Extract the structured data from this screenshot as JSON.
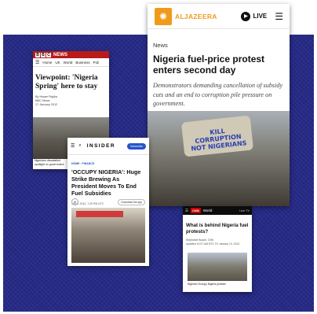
{
  "background_color": "#262a86",
  "bbc": {
    "logo_letters": [
      "B",
      "B",
      "C"
    ],
    "logo_word": "NEWS",
    "nav": [
      "Home",
      "UK",
      "World",
      "Business",
      "Poli"
    ],
    "headline": "Viewpoint: 'Nigeria Spring' here to stay",
    "byline": "By Hisam Rajika",
    "source": "BBC News",
    "date": "17 January 2012",
    "caption": "Nigerians dissatisfied spotlight on government",
    "accent": "#bb1919"
  },
  "aljazeera": {
    "brand": "ALJAZEERA",
    "live_label": "LIVE",
    "section": "News",
    "title": "Nigeria fuel-price protest enters second day",
    "subtitle": "Demonstrators demanding cancellation of subsidy cuts and an end to corruption pile pressure on government.",
    "sign_text": "KILL CORRUPTION NOT NIGERIANS",
    "accent": "#f09a1a"
  },
  "insider": {
    "brand": "INSIDER",
    "subscribe_label": "Subscribe",
    "breadcrumb": "HOME  ›  FINANCE",
    "title": "'OCCUPY NIGERIA': Huge Strike Brewing As President Moves To End Fuel Subsidies",
    "byline": "Jan 6, 2012, 7:20 PM UTC",
    "download_label": "Download the app",
    "accent": "#2554c7"
  },
  "cnn": {
    "logo": "CNN",
    "section": "World",
    "live_tv": "Live TV",
    "title": "What is behind Nigeria fuel protests?",
    "byline_name": "Stephanie Busari, CNN",
    "byline_date": "Updated 10:07 AM EST, Fri January 13, 2012",
    "caption": "Nigeria's Occupy Nigeria protests",
    "accent": "#cc0000"
  }
}
